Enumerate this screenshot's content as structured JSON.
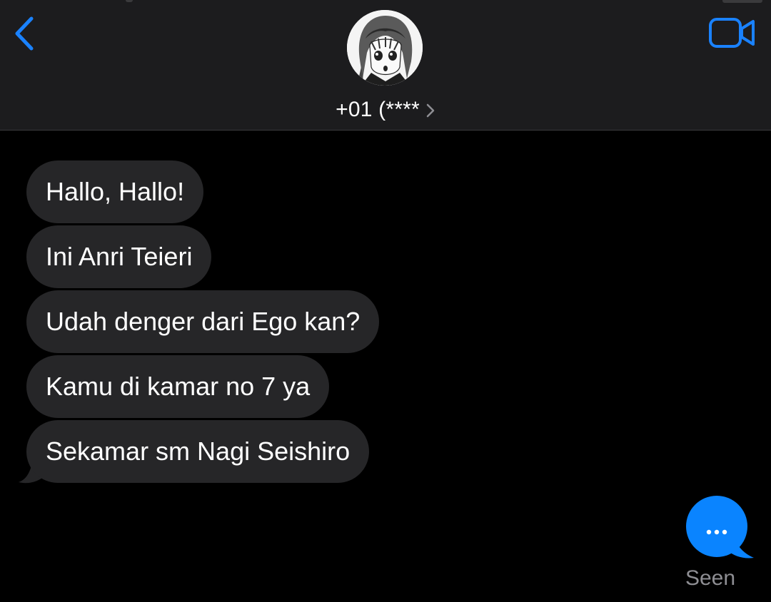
{
  "header": {
    "contact_name": "+01 (****",
    "back_icon": "chevron-left-icon",
    "video_icon": "video-camera-icon",
    "accent_color": "#1a82ff"
  },
  "messages": [
    {
      "text": "Hallo, Hallo!",
      "sender": "contact"
    },
    {
      "text": "Ini Anri Teieri",
      "sender": "contact"
    },
    {
      "text": "Udah denger dari Ego kan?",
      "sender": "contact"
    },
    {
      "text": "Kamu di kamar no 7 ya",
      "sender": "contact"
    },
    {
      "text": "Sekamar sm Nagi Seishiro",
      "sender": "contact"
    }
  ],
  "typing_indicator": {
    "icon": "ellipsis-icon",
    "color": "#0a84ff"
  },
  "status": {
    "seen_label": "Seen"
  },
  "colors": {
    "header_bg": "#1c1c1e",
    "bubble_bg": "#262628",
    "background": "#000000",
    "secondary_text": "#8e8e93"
  }
}
